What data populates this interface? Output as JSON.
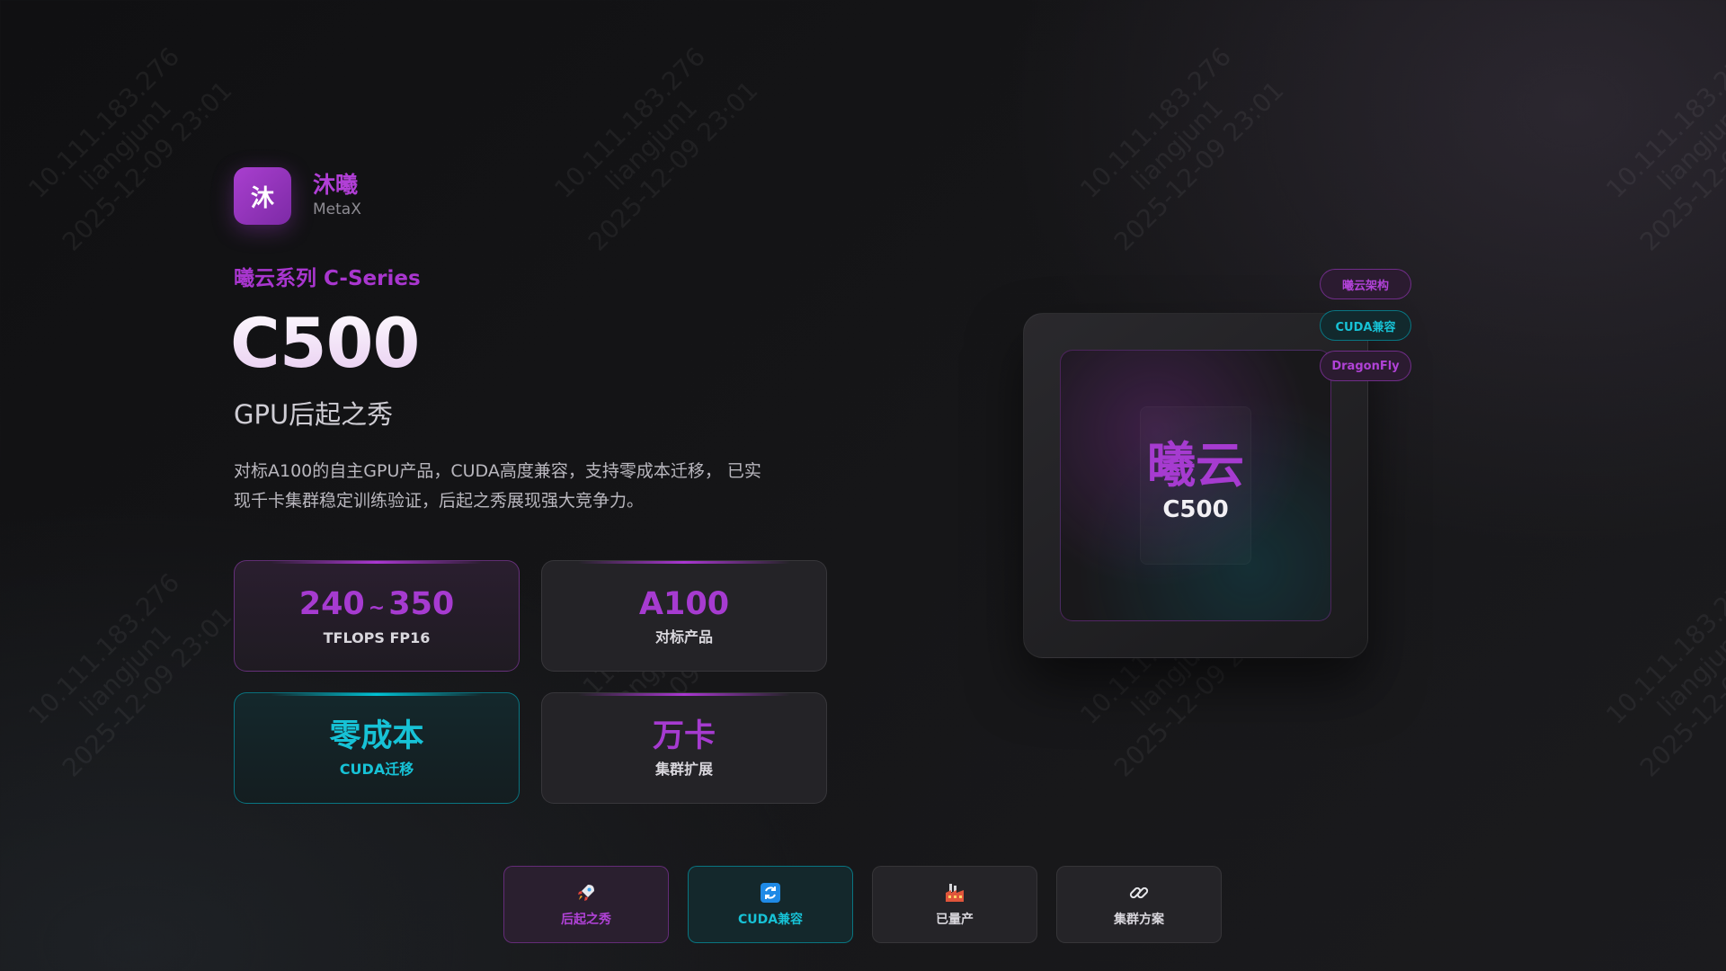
{
  "watermark": {
    "lines": [
      "10.111.183.276",
      "liangjun1",
      "2025-12-09 23:01"
    ]
  },
  "brand": {
    "logo_char": "沐",
    "name": "沐曦",
    "sub": "MetaX"
  },
  "hero": {
    "series": "曦云系列 C-Series",
    "model": "C500",
    "tagline": "GPU后起之秀",
    "description": "对标A100的自主GPU产品，CUDA高度兼容，支持零成本迁移， 已实现千卡集群稳定训练验证，后起之秀展现强大竞争力。"
  },
  "stats": [
    {
      "value_from": "240",
      "tilde": "~",
      "value_to": "350",
      "label": "TFLOPS FP16",
      "accent": "#a63bd0"
    },
    {
      "value": "A100",
      "label": "对标产品",
      "accent": "#a63bd0"
    },
    {
      "value": "零成本",
      "label": "CUDA迁移",
      "accent": "#17c2d6"
    },
    {
      "value": "万卡",
      "label": "集群扩展",
      "accent": "#a63bd0"
    }
  ],
  "chip": {
    "title": "曦云",
    "model": "C500"
  },
  "tags": [
    "曦云架构",
    "CUDA兼容",
    "DragonFly"
  ],
  "actions": [
    {
      "label": "后起之秀",
      "icon": "rocket-icon"
    },
    {
      "label": "CUDA兼容",
      "icon": "refresh-icon"
    },
    {
      "label": "已量产",
      "icon": "factory-icon"
    },
    {
      "label": "集群方案",
      "icon": "link-icon"
    }
  ],
  "colors": {
    "purple": "#a63bd0",
    "teal": "#17c2d6",
    "background": "#141416"
  }
}
